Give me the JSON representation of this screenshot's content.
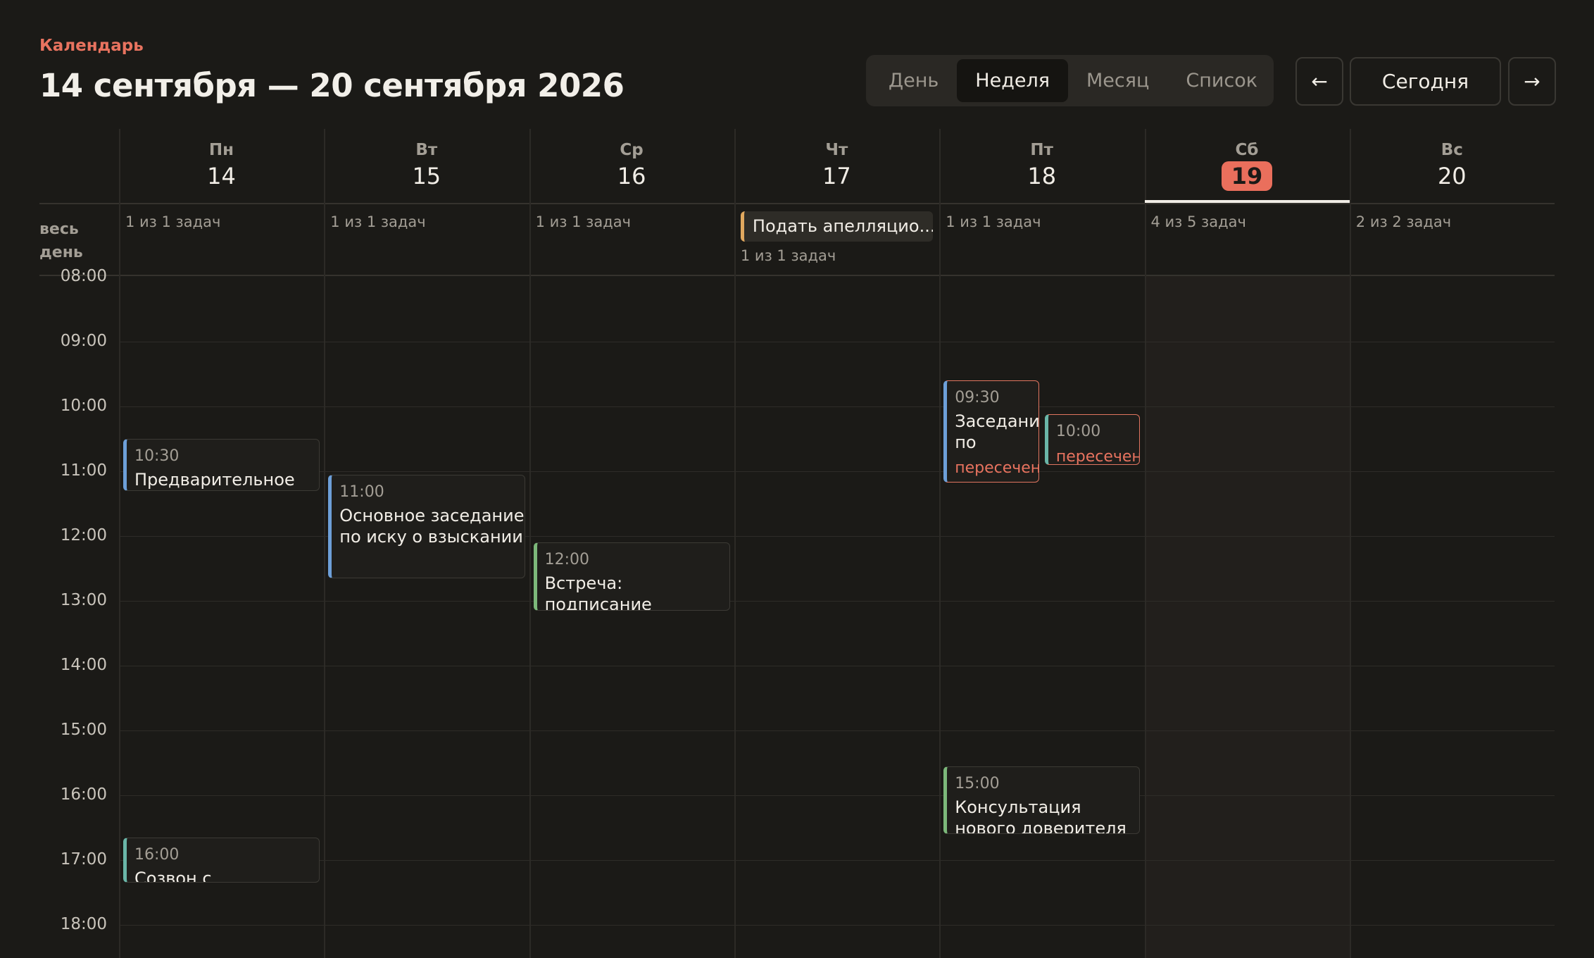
{
  "header": {
    "app_label": "Календарь",
    "range_title": "14 сентября — 20 сентября 2026"
  },
  "views": {
    "tabs": [
      {
        "label": "День",
        "active": false
      },
      {
        "label": "Неделя",
        "active": true
      },
      {
        "label": "Месяц",
        "active": false
      },
      {
        "label": "Список",
        "active": false
      }
    ]
  },
  "nav": {
    "prev_icon": "arrow-left-icon",
    "prev_glyph": "←",
    "today_label": "Сегодня",
    "next_icon": "arrow-right-icon",
    "next_glyph": "→"
  },
  "days": [
    {
      "dow": "Пн",
      "num": "14",
      "tasks": "1 из 1 задач",
      "today": false
    },
    {
      "dow": "Вт",
      "num": "15",
      "tasks": "1 из 1 задач",
      "today": false
    },
    {
      "dow": "Ср",
      "num": "16",
      "tasks": "1 из 1 задач",
      "today": false
    },
    {
      "dow": "Чт",
      "num": "17",
      "tasks": "1 из 1 задач",
      "today": false
    },
    {
      "dow": "Пт",
      "num": "18",
      "tasks": "1 из 1 задач",
      "today": false
    },
    {
      "dow": "Сб",
      "num": "19",
      "tasks": "4 из 5 задач",
      "today": true
    },
    {
      "dow": "Вс",
      "num": "20",
      "tasks": "2 из 2 задач",
      "today": false
    }
  ],
  "allday": {
    "label": "весь день",
    "chip": {
      "day": 3,
      "title": "Подать апелляцио...",
      "color": "#e0a85f"
    }
  },
  "hours": [
    "08:00",
    "09:00",
    "10:00",
    "11:00",
    "12:00",
    "13:00",
    "14:00",
    "15:00",
    "16:00",
    "17:00",
    "18:00"
  ],
  "events": [
    {
      "day": 0,
      "time": "10:30",
      "title": "Предварительное",
      "start": 10.5,
      "end": 11.3,
      "color": "blue",
      "conflict": false,
      "lane": 0,
      "lanes": 1
    },
    {
      "day": 1,
      "time": "11:00",
      "title": "Основное заседание по иску о взыскании",
      "start": 11.05,
      "end": 12.65,
      "color": "blue",
      "conflict": false,
      "lane": 0,
      "lanes": 1
    },
    {
      "day": 2,
      "time": "12:00",
      "title": "Встреча: подписание",
      "start": 12.1,
      "end": 13.15,
      "color": "green",
      "conflict": false,
      "lane": 0,
      "lanes": 1
    },
    {
      "day": 4,
      "time": "09:30",
      "title": "Заседание по",
      "warn": "пересечение",
      "start": 9.6,
      "end": 11.17,
      "color": "blue",
      "conflict": true,
      "lane": 0,
      "lanes": 2
    },
    {
      "day": 4,
      "time": "10:00",
      "warn": "пересечение",
      "start": 10.12,
      "end": 10.9,
      "color": "teal",
      "conflict": true,
      "lane": 1,
      "lanes": 2
    },
    {
      "day": 4,
      "time": "15:00",
      "title": "Консультация нового доверителя",
      "start": 15.55,
      "end": 16.6,
      "color": "green",
      "conflict": false,
      "lane": 0,
      "lanes": 1
    },
    {
      "day": 0,
      "time": "16:00",
      "title": "Созвон с",
      "start": 16.65,
      "end": 17.35,
      "color": "teal",
      "conflict": false,
      "lane": 0,
      "lanes": 1
    }
  ]
}
